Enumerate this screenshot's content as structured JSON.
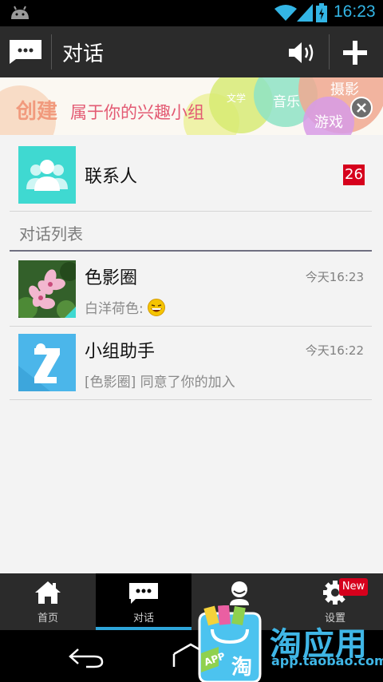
{
  "status_bar": {
    "time": "16:23"
  },
  "action_bar": {
    "title": "对话"
  },
  "banner": {
    "title": "创建",
    "subtitle": "属于你的兴趣小组",
    "tags": [
      "文学",
      "音乐",
      "摄影",
      "游戏"
    ]
  },
  "contacts": {
    "label": "联系人",
    "badge": "26"
  },
  "conversation_section": {
    "title": "对话列表"
  },
  "conversations": [
    {
      "name": "色影圈",
      "time": "今天16:23",
      "preview": "白洋荷色:"
    },
    {
      "name": "小组助手",
      "time": "今天16:22",
      "preview": "[色影圈] 同意了你的加入"
    }
  ],
  "tabs": [
    {
      "label": "首页",
      "icon": "home-icon"
    },
    {
      "label": "对话",
      "icon": "chat-icon",
      "active": true
    },
    {
      "label": "",
      "icon": "profile-icon"
    },
    {
      "label": "设置",
      "icon": "gear-icon",
      "badge": "New"
    }
  ],
  "watermark": {
    "brand": "淘应用",
    "url": "app.taobao.com",
    "bag_text": "淘",
    "tag": "APP"
  },
  "colors": {
    "accent": "#33b5e5",
    "teal": "#3fd9d1",
    "badge_red": "#d6001c",
    "tab_underline": "#2ea5d9"
  }
}
